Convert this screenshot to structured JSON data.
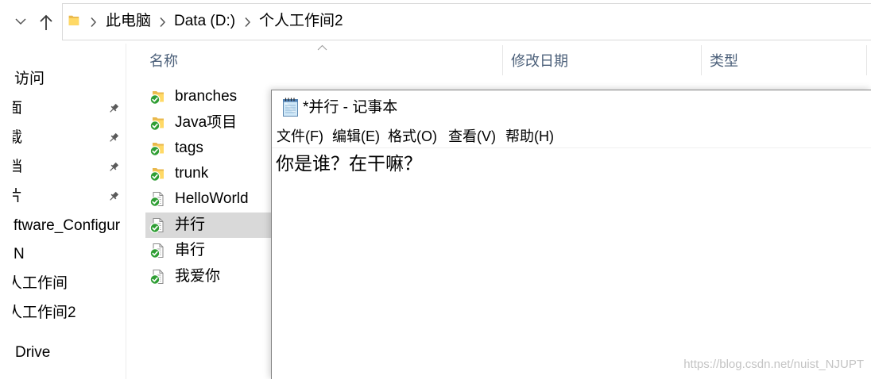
{
  "toolbar": {
    "recent_locations_icon": "chevron-down-icon",
    "up_icon": "up-arrow-icon"
  },
  "address_bar": {
    "location_icon": "folder-icon",
    "separator_icon": "chevron-right-icon",
    "segments": [
      "此电脑",
      "Data (D:)",
      "个人工作间2"
    ]
  },
  "sidebar": {
    "pin_icon": "pin-icon",
    "items": [
      {
        "label": "访问",
        "pinned": false
      },
      {
        "label": "面",
        "pinned": true
      },
      {
        "label": "载",
        "pinned": true
      },
      {
        "label": "档",
        "pinned": true
      },
      {
        "label": "片",
        "pinned": true
      },
      {
        "label": "ftware_Configur",
        "pinned": false
      },
      {
        "label": "N",
        "pinned": false
      },
      {
        "label": "人工作间",
        "pinned": false
      },
      {
        "label": "人工作间2",
        "pinned": false
      },
      {
        "label": "Drive",
        "pinned": false
      }
    ]
  },
  "file_list": {
    "sort_icon": "chevron-up-icon",
    "columns": [
      "名称",
      "修改日期",
      "类型"
    ],
    "items": [
      {
        "name": "branches",
        "icon": "folder-icon",
        "overlay": "svn-check-icon",
        "selected": false
      },
      {
        "name": "Java项目",
        "icon": "folder-icon",
        "overlay": "svn-check-icon",
        "selected": false
      },
      {
        "name": "tags",
        "icon": "folder-icon",
        "overlay": "svn-check-icon",
        "selected": false
      },
      {
        "name": "trunk",
        "icon": "folder-icon",
        "overlay": "svn-check-icon",
        "selected": false
      },
      {
        "name": "HelloWorld",
        "icon": "text-file-icon",
        "overlay": "svn-check-icon",
        "selected": false
      },
      {
        "name": "并行",
        "icon": "text-file-icon",
        "overlay": "svn-check-icon",
        "selected": true
      },
      {
        "name": "串行",
        "icon": "text-file-icon",
        "overlay": "svn-check-icon",
        "selected": false
      },
      {
        "name": "我爱你",
        "icon": "text-file-icon",
        "overlay": "svn-check-icon",
        "selected": false
      }
    ]
  },
  "notepad": {
    "icon": "notepad-icon",
    "title": "*并行 - 记事本",
    "menu": [
      "文件(F)",
      "编辑(E)",
      "格式(O)",
      "查看(V)",
      "帮助(H)"
    ],
    "content": "你是谁？在干嘛？"
  },
  "watermark": "https://blog.csdn.net/nuist_NJUPT",
  "colors": {
    "selected_row": "#d9d9d9",
    "column_header_text": "#4c607a",
    "folder": "#ffd966",
    "svn_check": "#2f9e34",
    "watermark": "#c4c4c4"
  }
}
